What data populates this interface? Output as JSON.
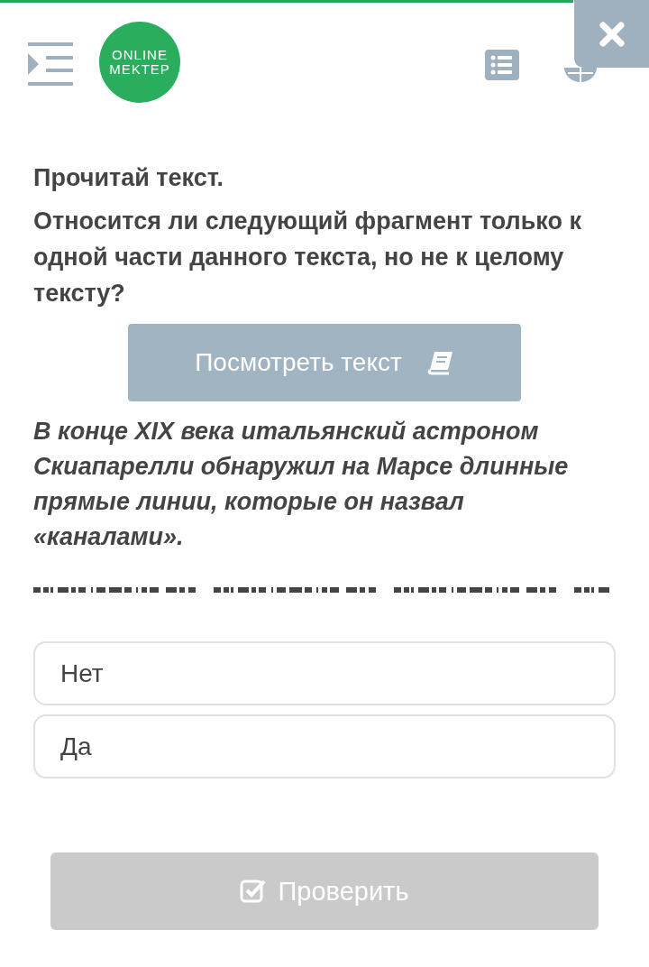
{
  "header": {
    "logo_lines": [
      "ONLINE",
      "MEKTEP"
    ]
  },
  "task": {
    "instruction": "Прочитай текст.",
    "question": "Относится ли следующий фрагмент только к одной части данного текста, но не к целому тексту?",
    "view_button": "Посмотреть текст",
    "fragment": "В конце XIX века итальянский астроном Скиапарелли обнаружил на Марсе длинные прямые линии, которые он назвал «каналами»."
  },
  "answers": [
    {
      "label": "Нет",
      "selected": false
    },
    {
      "label": "Да",
      "selected": false
    }
  ],
  "check_button": {
    "label": "Проверить",
    "disabled": true
  }
}
